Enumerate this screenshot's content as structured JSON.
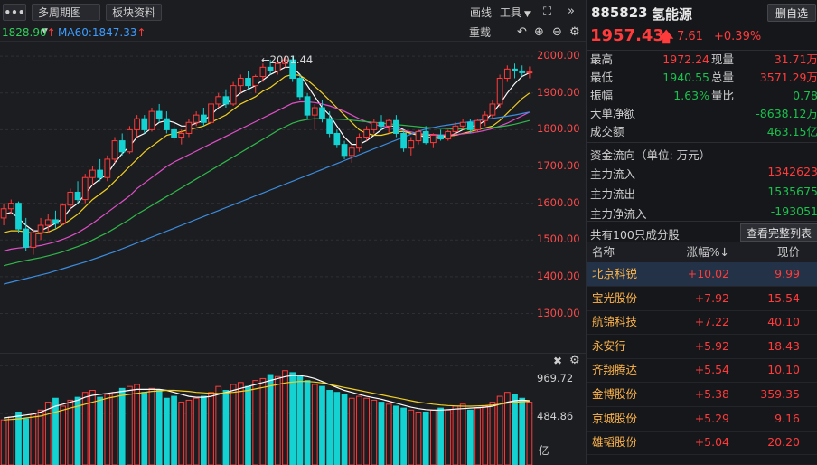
{
  "toolbar": {
    "menu_icon": "more-icon",
    "multi_period": "多周期图",
    "sector_info": "板块资料",
    "draw_line": "画线",
    "tools": "工具",
    "expand_icon": "expand-icon",
    "collapse_icon": "double-chevron-right-icon"
  },
  "ma_bar": {
    "ma_prev": "1828.90",
    "ma60": "MA60:1847.33",
    "reload": "重载"
  },
  "chart": {
    "high_marker": "2001.44",
    "y_ticks": [
      "2000.00",
      "1900.00",
      "1800.00",
      "1700.00",
      "1600.00",
      "1500.00",
      "1400.00",
      "1300.00"
    ],
    "vol_ticks": [
      "969.72",
      "484.86"
    ],
    "vol_unit": "亿"
  },
  "chart_data": {
    "type": "candlestick",
    "ylim": [
      1230,
      2020
    ],
    "ohlc": [
      [
        1560,
        1600,
        1540,
        1585
      ],
      [
        1585,
        1610,
        1570,
        1600
      ],
      [
        1600,
        1605,
        1520,
        1530
      ],
      [
        1530,
        1560,
        1470,
        1480
      ],
      [
        1480,
        1530,
        1460,
        1520
      ],
      [
        1520,
        1560,
        1500,
        1540
      ],
      [
        1540,
        1570,
        1520,
        1555
      ],
      [
        1555,
        1580,
        1530,
        1545
      ],
      [
        1545,
        1600,
        1540,
        1595
      ],
      [
        1595,
        1640,
        1580,
        1630
      ],
      [
        1630,
        1660,
        1600,
        1610
      ],
      [
        1610,
        1680,
        1600,
        1670
      ],
      [
        1670,
        1700,
        1650,
        1690
      ],
      [
        1690,
        1720,
        1660,
        1670
      ],
      [
        1670,
        1730,
        1660,
        1720
      ],
      [
        1720,
        1780,
        1710,
        1770
      ],
      [
        1770,
        1790,
        1730,
        1740
      ],
      [
        1740,
        1810,
        1735,
        1800
      ],
      [
        1800,
        1840,
        1780,
        1830
      ],
      [
        1830,
        1840,
        1790,
        1800
      ],
      [
        1800,
        1860,
        1795,
        1850
      ],
      [
        1850,
        1870,
        1820,
        1830
      ],
      [
        1830,
        1850,
        1790,
        1800
      ],
      [
        1800,
        1820,
        1770,
        1780
      ],
      [
        1780,
        1800,
        1760,
        1790
      ],
      [
        1790,
        1830,
        1780,
        1820
      ],
      [
        1820,
        1850,
        1810,
        1840
      ],
      [
        1840,
        1860,
        1810,
        1820
      ],
      [
        1820,
        1880,
        1815,
        1870
      ],
      [
        1870,
        1900,
        1860,
        1890
      ],
      [
        1890,
        1910,
        1860,
        1870
      ],
      [
        1870,
        1930,
        1865,
        1920
      ],
      [
        1920,
        1950,
        1900,
        1940
      ],
      [
        1940,
        1960,
        1910,
        1920
      ],
      [
        1920,
        1950,
        1900,
        1945
      ],
      [
        1945,
        1980,
        1930,
        1970
      ],
      [
        1970,
        1990,
        1950,
        1960
      ],
      [
        1960,
        1985,
        1950,
        1980
      ],
      [
        1980,
        2001,
        1970,
        1990
      ],
      [
        1990,
        2000,
        1930,
        1940
      ],
      [
        1940,
        1950,
        1880,
        1890
      ],
      [
        1890,
        1900,
        1830,
        1840
      ],
      [
        1840,
        1870,
        1800,
        1860
      ],
      [
        1860,
        1880,
        1820,
        1830
      ],
      [
        1830,
        1850,
        1780,
        1790
      ],
      [
        1790,
        1800,
        1750,
        1760
      ],
      [
        1760,
        1770,
        1720,
        1730
      ],
      [
        1730,
        1760,
        1710,
        1750
      ],
      [
        1750,
        1790,
        1740,
        1780
      ],
      [
        1780,
        1810,
        1770,
        1800
      ],
      [
        1800,
        1830,
        1790,
        1820
      ],
      [
        1820,
        1840,
        1800,
        1810
      ],
      [
        1810,
        1830,
        1790,
        1825
      ],
      [
        1825,
        1840,
        1780,
        1790
      ],
      [
        1790,
        1800,
        1740,
        1750
      ],
      [
        1750,
        1780,
        1730,
        1770
      ],
      [
        1770,
        1800,
        1760,
        1795
      ],
      [
        1795,
        1810,
        1760,
        1765
      ],
      [
        1765,
        1790,
        1750,
        1785
      ],
      [
        1785,
        1800,
        1770,
        1775
      ],
      [
        1775,
        1800,
        1770,
        1795
      ],
      [
        1795,
        1820,
        1785,
        1810
      ],
      [
        1810,
        1830,
        1800,
        1820
      ],
      [
        1820,
        1830,
        1790,
        1800
      ],
      [
        1800,
        1830,
        1795,
        1825
      ],
      [
        1825,
        1850,
        1810,
        1840
      ],
      [
        1840,
        1880,
        1830,
        1870
      ],
      [
        1870,
        1950,
        1860,
        1940
      ],
      [
        1940,
        1975,
        1930,
        1965
      ],
      [
        1965,
        1980,
        1940,
        1960
      ],
      [
        1960,
        1975,
        1945,
        1955
      ],
      [
        1955,
        1972,
        1940,
        1957
      ]
    ],
    "ma_series": [
      {
        "color": "#ffffff",
        "values": [
          1570,
          1575,
          1560,
          1540,
          1525,
          1525,
          1535,
          1545,
          1560,
          1585,
          1600,
          1625,
          1650,
          1665,
          1680,
          1710,
          1735,
          1755,
          1780,
          1790,
          1805,
          1820,
          1825,
          1820,
          1810,
          1810,
          1818,
          1825,
          1840,
          1860,
          1870,
          1885,
          1900,
          1910,
          1920,
          1935,
          1950,
          1960,
          1970,
          1970,
          1950,
          1920,
          1890,
          1860,
          1840,
          1810,
          1780,
          1760,
          1760,
          1770,
          1785,
          1800,
          1810,
          1810,
          1800,
          1790,
          1785,
          1780,
          1778,
          1780,
          1782,
          1790,
          1800,
          1808,
          1812,
          1825,
          1845,
          1870,
          1900,
          1925,
          1945,
          1955
        ]
      },
      {
        "color": "#f2d021",
        "values": [
          1520,
          1525,
          1525,
          1522,
          1518,
          1518,
          1522,
          1530,
          1542,
          1555,
          1570,
          1590,
          1610,
          1625,
          1640,
          1660,
          1680,
          1700,
          1720,
          1740,
          1755,
          1770,
          1785,
          1790,
          1795,
          1800,
          1805,
          1810,
          1820,
          1830,
          1840,
          1855,
          1870,
          1880,
          1890,
          1905,
          1915,
          1930,
          1945,
          1950,
          1948,
          1935,
          1918,
          1900,
          1880,
          1860,
          1840,
          1820,
          1800,
          1790,
          1785,
          1785,
          1790,
          1795,
          1795,
          1790,
          1788,
          1785,
          1785,
          1784,
          1783,
          1785,
          1790,
          1795,
          1800,
          1805,
          1810,
          1825,
          1845,
          1865,
          1885,
          1900
        ]
      },
      {
        "color": "#e04fc8",
        "values": [
          1470,
          1475,
          1478,
          1480,
          1482,
          1485,
          1490,
          1495,
          1502,
          1510,
          1520,
          1532,
          1545,
          1560,
          1575,
          1590,
          1605,
          1620,
          1640,
          1655,
          1670,
          1685,
          1700,
          1712,
          1722,
          1732,
          1742,
          1752,
          1762,
          1772,
          1782,
          1792,
          1802,
          1812,
          1822,
          1832,
          1842,
          1852,
          1862,
          1872,
          1876,
          1876,
          1874,
          1870,
          1865,
          1858,
          1850,
          1840,
          1830,
          1822,
          1815,
          1810,
          1806,
          1802,
          1798,
          1794,
          1790,
          1788,
          1787,
          1786,
          1786,
          1787,
          1789,
          1791,
          1794,
          1798,
          1803,
          1810,
          1818,
          1828,
          1838,
          1848
        ]
      },
      {
        "color": "#2fb84a",
        "values": [
          1430,
          1435,
          1440,
          1444,
          1448,
          1452,
          1457,
          1462,
          1468,
          1475,
          1482,
          1490,
          1500,
          1510,
          1520,
          1532,
          1544,
          1556,
          1570,
          1582,
          1594,
          1606,
          1618,
          1630,
          1642,
          1654,
          1666,
          1678,
          1690,
          1702,
          1714,
          1726,
          1738,
          1750,
          1762,
          1774,
          1786,
          1798,
          1808,
          1818,
          1824,
          1828,
          1830,
          1830,
          1830,
          1829,
          1828,
          1826,
          1824,
          1822,
          1820,
          1818,
          1816,
          1814,
          1812,
          1810,
          1808,
          1806,
          1805,
          1804,
          1803,
          1802,
          1802,
          1802,
          1803,
          1804,
          1806,
          1808,
          1811,
          1815,
          1820,
          1825
        ]
      },
      {
        "color": "#3c8de0",
        "values": [
          1380,
          1385,
          1390,
          1395,
          1400,
          1405,
          1410,
          1416,
          1422,
          1428,
          1434,
          1440,
          1447,
          1454,
          1461,
          1468,
          1476,
          1484,
          1492,
          1500,
          1508,
          1516,
          1524,
          1532,
          1540,
          1548,
          1556,
          1564,
          1572,
          1580,
          1588,
          1596,
          1604,
          1612,
          1620,
          1628,
          1636,
          1644,
          1652,
          1660,
          1668,
          1676,
          1684,
          1692,
          1700,
          1708,
          1716,
          1724,
          1732,
          1740,
          1748,
          1756,
          1764,
          1772,
          1780,
          1788,
          1796,
          1802,
          1806,
          1810,
          1813,
          1816,
          1819,
          1822,
          1825,
          1828,
          1831,
          1834,
          1837,
          1840,
          1844,
          1848
        ]
      }
    ],
    "volume": [
      420,
      450,
      500,
      430,
      480,
      520,
      600,
      640,
      560,
      620,
      650,
      700,
      720,
      650,
      680,
      700,
      740,
      760,
      780,
      700,
      740,
      720,
      640,
      660,
      600,
      620,
      640,
      660,
      700,
      760,
      720,
      780,
      800,
      760,
      820,
      840,
      880,
      860,
      920,
      900,
      860,
      820,
      780,
      760,
      720,
      700,
      680,
      640,
      660,
      640,
      620,
      600,
      580,
      560,
      540,
      520,
      500,
      500,
      520,
      540,
      520,
      560,
      580,
      520,
      540,
      560,
      600,
      660,
      700,
      680,
      640,
      600
    ],
    "vol_ma": [
      {
        "color": "#ffffff",
        "values": [
          440,
          450,
          460,
          470,
          480,
          500,
          530,
          560,
          580,
          600,
          620,
          650,
          670,
          680,
          690,
          700,
          710,
          720,
          730,
          730,
          730,
          730,
          720,
          700,
          680,
          660,
          650,
          650,
          660,
          680,
          700,
          720,
          740,
          760,
          780,
          800,
          820,
          840,
          860,
          870,
          870,
          860,
          840,
          810,
          780,
          750,
          720,
          700,
          680,
          660,
          645,
          630,
          610,
          590,
          570,
          550,
          535,
          525,
          520,
          520,
          525,
          530,
          535,
          540,
          545,
          550,
          560,
          580,
          600,
          615,
          620,
          615
        ]
      },
      {
        "color": "#f2d021",
        "values": [
          420,
          425,
          430,
          440,
          450,
          460,
          480,
          500,
          520,
          540,
          560,
          580,
          600,
          620,
          640,
          655,
          670,
          680,
          690,
          700,
          710,
          715,
          720,
          720,
          715,
          710,
          700,
          695,
          690,
          690,
          695,
          700,
          710,
          720,
          735,
          750,
          765,
          780,
          795,
          805,
          810,
          810,
          805,
          795,
          780,
          765,
          750,
          735,
          720,
          705,
          690,
          675,
          660,
          645,
          630,
          615,
          600,
          590,
          580,
          572,
          566,
          562,
          560,
          560,
          562,
          566,
          572,
          580,
          590,
          600,
          605,
          608
        ]
      }
    ]
  },
  "panel": {
    "code": "885823",
    "name": "氢能源",
    "delete_btn": "删自选",
    "price": "1957.43",
    "arrow": "up-arrow-icon",
    "change": "7.61",
    "change_pct": "+0.39%",
    "stats": [
      {
        "l1": "最高",
        "v1": "1972.24",
        "l2": "现量",
        "v2": "31.71万"
      },
      {
        "l1": "最低",
        "v1": "1940.55",
        "l2": "总量",
        "v2": "3571.29万"
      },
      {
        "l1": "振幅",
        "v1": "1.63%",
        "l2": "量比",
        "v2": "0.78"
      }
    ],
    "big_net_label": "大单净额",
    "big_net_val": "-8638.12万",
    "amount_label": "成交额",
    "amount_val": "463.15亿",
    "flow_title": "资金流向（单位: 万元）",
    "main_in_label": "主力流入",
    "main_in_val": "1342623",
    "main_out_label": "主力流出",
    "main_out_val": "1535675",
    "main_net_label": "主力净流入",
    "main_net_val": "-193051",
    "constituents_label": "共有100只成分股",
    "view_all": "查看完整列表",
    "col_name": "名称",
    "col_pct": "涨幅%↓",
    "col_price": "现价",
    "rows": [
      {
        "name": "北京科锐",
        "pct": "+10.02",
        "price": "9.99"
      },
      {
        "name": "宝光股份",
        "pct": "+7.92",
        "price": "15.54"
      },
      {
        "name": "航锦科技",
        "pct": "+7.22",
        "price": "40.10"
      },
      {
        "name": "永安行",
        "pct": "+5.92",
        "price": "18.43"
      },
      {
        "name": "齐翔腾达",
        "pct": "+5.54",
        "price": "10.10"
      },
      {
        "name": "金博股份",
        "pct": "+5.38",
        "price": "359.35"
      },
      {
        "name": "京城股份",
        "pct": "+5.29",
        "price": "9.16"
      },
      {
        "name": "雄韬股份",
        "pct": "+5.04",
        "price": "20.20"
      }
    ]
  }
}
